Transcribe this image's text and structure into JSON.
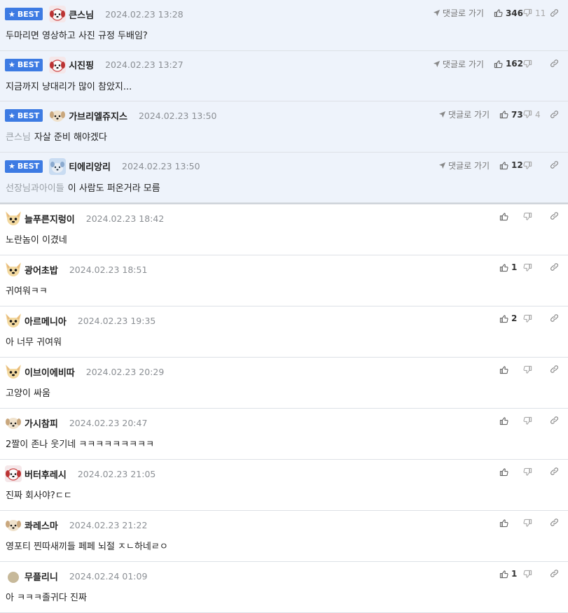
{
  "labels": {
    "best": "BEST",
    "reply": "댓글로 가기"
  },
  "comments": [
    {
      "best": true,
      "avatar": "puppy-red-icon",
      "nick": "큰스님",
      "date": "2024.02.23 13:28",
      "body": "두마리면 영상하고 사진 규정 두배임?",
      "mention": "",
      "up": "346",
      "down": "11"
    },
    {
      "best": true,
      "avatar": "puppy-red-icon",
      "nick": "시진핑",
      "date": "2024.02.23 13:27",
      "body": "지금까지 냥대리가 많이 참았지...",
      "mention": "",
      "up": "162",
      "down": ""
    },
    {
      "best": true,
      "avatar": "pup-face-icon",
      "nick": "가브리엘쥬지스",
      "date": "2024.02.23 13:50",
      "body": "자살 준비 해야겠다",
      "mention": "큰스님",
      "up": "73",
      "down": "4"
    },
    {
      "best": true,
      "avatar": "blue-dog-icon",
      "nick": "티에리앙리",
      "date": "2024.02.23 13:50",
      "body": "이 사람도 퍼온거라 모름",
      "mention": "선장님과아이들",
      "up": "12",
      "down": ""
    },
    {
      "best": false,
      "avatar": "chihuahua-icon",
      "nick": "늘푸른지렁이",
      "date": "2024.02.23 18:42",
      "body": "노란놈이 이겼네",
      "mention": "",
      "up": "",
      "down": ""
    },
    {
      "best": false,
      "avatar": "chihuahua-icon",
      "nick": "광어초밥",
      "date": "2024.02.23 18:51",
      "body": "귀여워ㅋㅋ",
      "mention": "",
      "up": "1",
      "down": ""
    },
    {
      "best": false,
      "avatar": "chihuahua-icon",
      "nick": "아르메니아",
      "date": "2024.02.23 19:35",
      "body": "아 너무 귀여워",
      "mention": "",
      "up": "2",
      "down": ""
    },
    {
      "best": false,
      "avatar": "chihuahua-icon",
      "nick": "이브이에비따",
      "date": "2024.02.23 20:29",
      "body": "고양이 싸움",
      "mention": "",
      "up": "",
      "down": ""
    },
    {
      "best": false,
      "avatar": "pup-face-icon",
      "nick": "가시참피",
      "date": "2024.02.23 20:47",
      "body": "2짤이 존나 웃기네 ㅋㅋㅋㅋㅋㅋㅋㅋㅋ",
      "mention": "",
      "up": "",
      "down": ""
    },
    {
      "best": false,
      "avatar": "puppy-red-icon",
      "nick": "버터후레시",
      "date": "2024.02.23 21:05",
      "body": "진짜 회사야?ㄷㄷ",
      "mention": "",
      "up": "",
      "down": ""
    },
    {
      "best": false,
      "avatar": "pup-face-icon",
      "nick": "콰레스마",
      "date": "2024.02.23 21:22",
      "body": "영포티 찐따새끼들 페페 뇌절 ㅈㄴ하네ㄹㅇ",
      "mention": "",
      "up": "",
      "down": ""
    },
    {
      "best": false,
      "avatar": "beige-circle-icon",
      "nick": "무플리니",
      "date": "2024.02.24 01:09",
      "body": "아 ㅋㅋㅋ졸귀다 진짜",
      "mention": "",
      "up": "1",
      "down": ""
    }
  ],
  "colors": {
    "best_bg": "#eef3fb",
    "badge": "#3d7be3",
    "date": "#8b8f94",
    "mention": "#9aa0a6"
  }
}
